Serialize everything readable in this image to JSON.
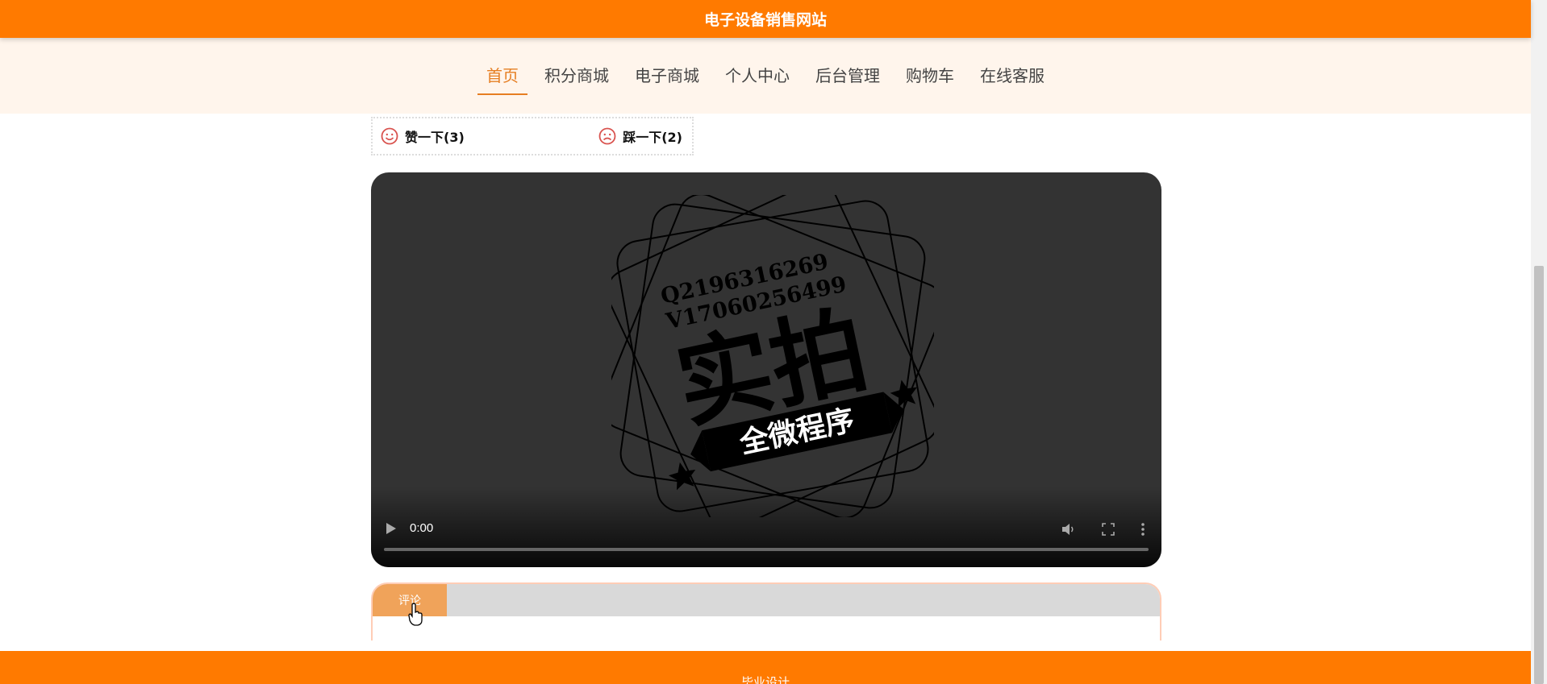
{
  "header": {
    "title": "电子设备销售网站"
  },
  "nav": {
    "items": [
      {
        "label": "首页",
        "active": true
      },
      {
        "label": "积分商城"
      },
      {
        "label": "电子商城"
      },
      {
        "label": "个人中心"
      },
      {
        "label": "后台管理"
      },
      {
        "label": "购物车"
      },
      {
        "label": "在线客服"
      }
    ]
  },
  "vote": {
    "like_label": "赞一下(3)",
    "dislike_label": "踩一下(2)"
  },
  "video": {
    "poster_lines": [
      "Q2196316269",
      "V17060256499"
    ],
    "poster_main": "实拍",
    "poster_banner": "全微程序",
    "time": "0:00",
    "progress": 0
  },
  "tabs": {
    "comment_label": "评论"
  },
  "footer": {
    "text": "毕业设计"
  },
  "colors": {
    "brand": "#ff7a00",
    "nav_bg": "#fff5ec",
    "active": "#e67e22",
    "tab": "#f0a35a"
  }
}
